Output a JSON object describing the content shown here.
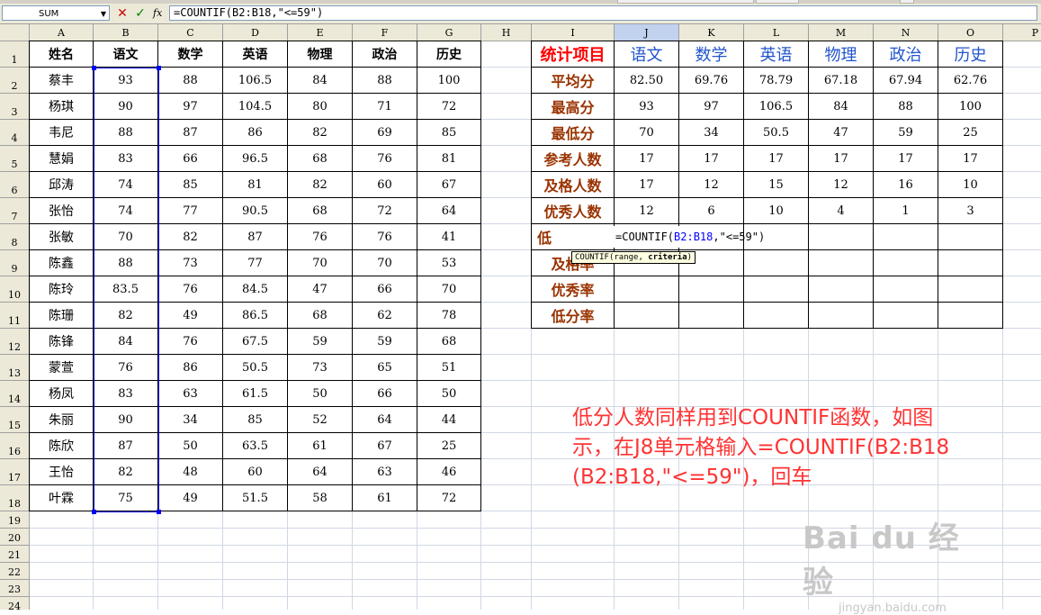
{
  "formula_bar": {
    "name_box": "SUM",
    "cancel_glyph": "✕",
    "enter_glyph": "✓",
    "fx_label": "fx",
    "formula": "=COUNTIF(B2:B18,\"<=59\")"
  },
  "columns": [
    "A",
    "B",
    "C",
    "D",
    "E",
    "F",
    "G",
    "H",
    "I",
    "J",
    "K",
    "L",
    "M",
    "N",
    "O",
    "P"
  ],
  "selected_column": "J",
  "rows": [
    "1",
    "2",
    "3",
    "4",
    "5",
    "6",
    "7",
    "8",
    "9",
    "10",
    "11",
    "12",
    "13",
    "14",
    "15",
    "16",
    "17",
    "18",
    "19",
    "20",
    "21",
    "22",
    "23",
    "24"
  ],
  "scores": {
    "headers": [
      "姓名",
      "语文",
      "数学",
      "英语",
      "物理",
      "政治",
      "历史"
    ],
    "rows": [
      [
        "蔡丰",
        "93",
        "88",
        "106.5",
        "84",
        "88",
        "100"
      ],
      [
        "杨琪",
        "90",
        "97",
        "104.5",
        "80",
        "71",
        "72"
      ],
      [
        "韦尼",
        "88",
        "87",
        "86",
        "82",
        "69",
        "85"
      ],
      [
        "慧娟",
        "83",
        "66",
        "96.5",
        "68",
        "76",
        "81"
      ],
      [
        "邱涛",
        "74",
        "85",
        "81",
        "82",
        "60",
        "67"
      ],
      [
        "张怡",
        "74",
        "77",
        "90.5",
        "68",
        "72",
        "64"
      ],
      [
        "张敏",
        "70",
        "82",
        "87",
        "76",
        "76",
        "41"
      ],
      [
        "陈鑫",
        "88",
        "73",
        "77",
        "70",
        "70",
        "53"
      ],
      [
        "陈玲",
        "83.5",
        "76",
        "84.5",
        "47",
        "66",
        "70"
      ],
      [
        "陈珊",
        "82",
        "49",
        "86.5",
        "68",
        "62",
        "78"
      ],
      [
        "陈锋",
        "84",
        "76",
        "67.5",
        "59",
        "59",
        "68"
      ],
      [
        "蒙萱",
        "76",
        "86",
        "50.5",
        "73",
        "65",
        "51"
      ],
      [
        "杨凤",
        "83",
        "63",
        "61.5",
        "50",
        "66",
        "50"
      ],
      [
        "朱丽",
        "90",
        "34",
        "85",
        "52",
        "64",
        "44"
      ],
      [
        "陈欣",
        "87",
        "50",
        "63.5",
        "61",
        "67",
        "25"
      ],
      [
        "王怡",
        "82",
        "48",
        "60",
        "64",
        "63",
        "46"
      ],
      [
        "叶霖",
        "75",
        "49",
        "51.5",
        "58",
        "61",
        "72"
      ]
    ]
  },
  "stats": {
    "header_label": "统计项目",
    "subjects": [
      "语文",
      "数学",
      "英语",
      "物理",
      "政治",
      "历史"
    ],
    "rows": [
      {
        "label": "平均分",
        "values": [
          "82.50",
          "69.76",
          "78.79",
          "67.18",
          "67.94",
          "62.76"
        ]
      },
      {
        "label": "最高分",
        "values": [
          "93",
          "97",
          "106.5",
          "84",
          "88",
          "100"
        ]
      },
      {
        "label": "最低分",
        "values": [
          "70",
          "34",
          "50.5",
          "47",
          "59",
          "25"
        ]
      },
      {
        "label": "参考人数",
        "values": [
          "17",
          "17",
          "17",
          "17",
          "17",
          "17"
        ]
      },
      {
        "label": "及格人数",
        "values": [
          "17",
          "12",
          "15",
          "12",
          "16",
          "10"
        ]
      },
      {
        "label": "优秀人数",
        "values": [
          "12",
          "6",
          "10",
          "4",
          "1",
          "3"
        ]
      },
      {
        "label": "低",
        "values": [
          "",
          "",
          "",
          "",
          "",
          ""
        ]
      },
      {
        "label": "及格率",
        "values": [
          "",
          "",
          "",
          "",
          "",
          ""
        ]
      },
      {
        "label": "优秀率",
        "values": [
          "",
          "",
          "",
          "",
          "",
          ""
        ]
      },
      {
        "label": "低分率",
        "values": [
          "",
          "",
          "",
          "",
          "",
          ""
        ]
      }
    ]
  },
  "editing_cell": {
    "prefix": "=COUNTIF(",
    "ref": "B2:B18",
    "suffix": ",\"<=59\")"
  },
  "tooltip": {
    "fn": "COUNTIF",
    "args_plain": "(range, ",
    "args_bold": "criteria",
    "close": ")"
  },
  "annotation": {
    "line1": "低分人数同样用到COUNTIF函数，如图",
    "line2": "示，在J8单元格输入=COUNTIF(B2:B18",
    "line3": "(B2:B18,\"<=59\")，回车"
  },
  "watermark": {
    "logo": "Bai du 经验",
    "sub": "jingyan.baidu.com"
  },
  "colors": {
    "stat_header": "#ff0000",
    "stat_label": "#993300",
    "subject": "#2255cc",
    "selection": "#0000ff",
    "annotation": "#ff3333"
  }
}
